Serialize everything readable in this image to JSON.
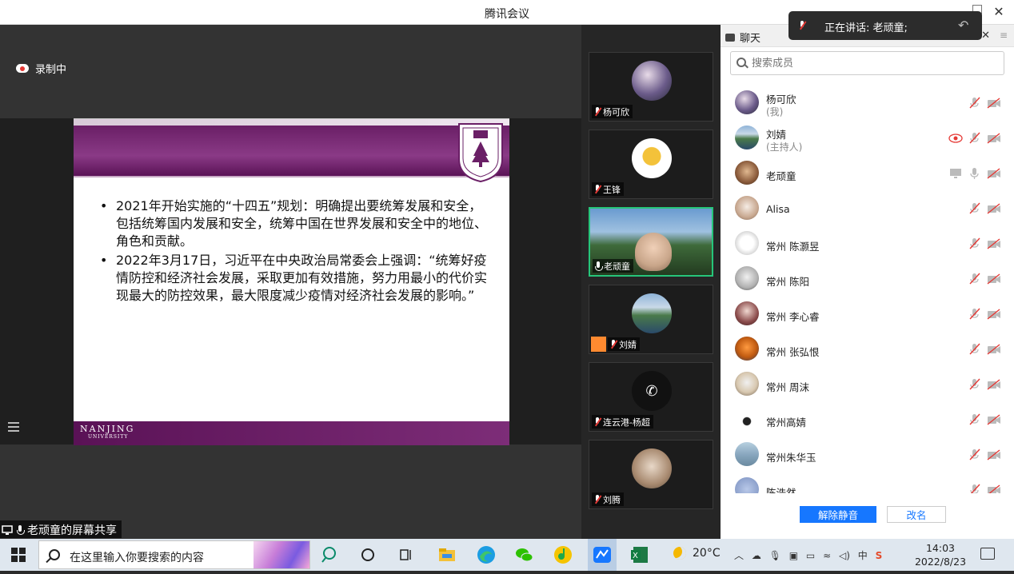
{
  "window": {
    "title": "腾讯会议"
  },
  "recording": {
    "label": "录制中"
  },
  "slide": {
    "bullets": [
      "2021年开始实施的“十四五”规划：明确提出要统筹发展和安全，包括统筹国内发展和安全，统筹中国在世界发展和安全中的地位、角色和贡献。",
      "2022年3月17日，习近平在中央政治局常委会上强调：“统筹好疫情防控和经济社会发展，采取更加有效措施，努力用最小的代价实现最大的防控效果，最大限度减少疫情对经济社会发展的影响。”"
    ],
    "footer_line1": "NANJING",
    "footer_line2": "UNIVERSITY"
  },
  "screen_share_label": "老顽童的屏幕共享",
  "speaking_banner": {
    "text": "正在讲话: 老顽童;"
  },
  "gallery": [
    {
      "name": "杨可欣",
      "mic": "off",
      "active": false
    },
    {
      "name": "王锋",
      "mic": "off",
      "active": false
    },
    {
      "name": "老顽童",
      "mic": "on",
      "active": true
    },
    {
      "name": "刘婧",
      "mic": "off",
      "active": false,
      "host_badge": true
    },
    {
      "name": "连云港-杨超",
      "mic": "off",
      "active": false
    },
    {
      "name": "刘腾",
      "mic": "off",
      "active": false
    }
  ],
  "panel": {
    "chat_tab": "聊天",
    "search_placeholder": "搜索成员",
    "members": [
      {
        "name": "杨可欣",
        "role": "(我)",
        "mic": "off",
        "cam": "off"
      },
      {
        "name": "刘婧",
        "role": "(主持人)",
        "mic": "off",
        "cam": "off",
        "recording": true
      },
      {
        "name": "老顽童",
        "role": "",
        "mic": "on",
        "cam": "off",
        "sharing": true
      },
      {
        "name": "Alisa",
        "role": "",
        "mic": "off",
        "cam": "off"
      },
      {
        "name": "常州  陈灏昱",
        "role": "",
        "mic": "off",
        "cam": "off"
      },
      {
        "name": "常州 陈阳",
        "role": "",
        "mic": "off",
        "cam": "off"
      },
      {
        "name": "常州 李心睿",
        "role": "",
        "mic": "off",
        "cam": "off"
      },
      {
        "name": "常州 张弘恨",
        "role": "",
        "mic": "off",
        "cam": "off"
      },
      {
        "name": "常州 周沫",
        "role": "",
        "mic": "off",
        "cam": "off"
      },
      {
        "name": "常州高婧",
        "role": "",
        "mic": "off",
        "cam": "off"
      },
      {
        "name": "常州朱华玉",
        "role": "",
        "mic": "off",
        "cam": "off"
      },
      {
        "name": "陈浩然",
        "role": "",
        "mic": "off",
        "cam": "off"
      }
    ],
    "unmute_button": "解除静音",
    "rename_button": "改名"
  },
  "taskbar": {
    "search_placeholder": "在这里输入你要搜索的内容",
    "temperature": "20°C",
    "time": "14:03",
    "date": "2022/8/23",
    "ime": "中"
  },
  "colors": {
    "accent": "#1677ff",
    "slide_purple": "#6a1f66",
    "active_tile": "#26c57a",
    "muted_red": "#e53935"
  }
}
